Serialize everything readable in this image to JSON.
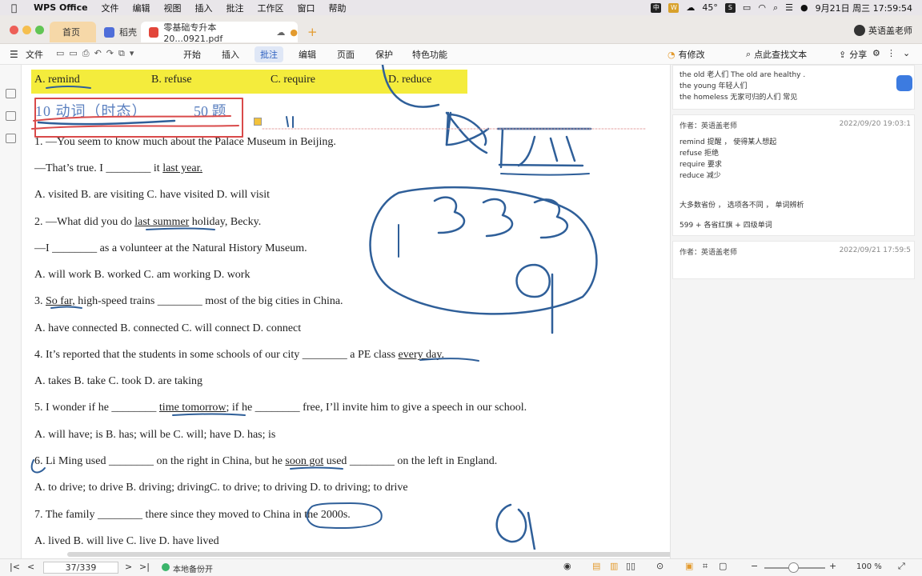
{
  "menubar": {
    "app": "WPS Office",
    "items": [
      "文件",
      "编辑",
      "视图",
      "插入",
      "批注",
      "工作区",
      "窗口",
      "帮助"
    ],
    "temp": "45°",
    "datetime": "9月21日 周三  17:59:54"
  },
  "tabs": {
    "home": "首页",
    "daoke": "稻壳",
    "doc": "零基础专升本20...0921.pdf"
  },
  "user": "英语盖老师",
  "toolbar": {
    "file": "文件",
    "menus": [
      "开始",
      "插入",
      "批注",
      "编辑",
      "页面",
      "保护",
      "特色功能"
    ],
    "active": "批注",
    "changes": "有修改",
    "search": "点此查找文本",
    "share": "分享"
  },
  "doc": {
    "options_top": [
      "A.  remind",
      "B.  refuse",
      "C.  require",
      "D.  reduce"
    ],
    "heading": "10   动词（时态）",
    "heading_count": "50 题",
    "q1a": "1.  —You seem to know much about the Palace Museum in Beijing.",
    "q1b_pre": "—That’s true. I ________ it ",
    "q1b_ul": "last year.",
    "q1opts": "A.  visited      B.  are visiting      C.  have visited      D.  will visit",
    "q2a_pre": "2.  —What did you do ",
    "q2a_ul": "last summer",
    "q2a_post": " holiday, Becky.",
    "q2b": "—I ________ as a volunteer at the Natural History Museum.",
    "q2opts": "A.  will work  B.  worked     C.  am working     D.  work",
    "q3_pre": "3.  ",
    "q3_ul": "So far,",
    "q3_post": " high-speed trains ________ most of the big cities in China.",
    "q3opts": "A.  have connected B.  connected C.  will connect     D.  connect",
    "q4_pre": "4.  It’s reported that the students in some schools of our city ________ a PE class ",
    "q4_ul": "every day.",
    "q4opts": "A.  takes B.  take  C.  took  D.  are taking",
    "q5_pre": "5.  I wonder if he ________ ",
    "q5_ul": "time tomorrow",
    "q5_post": "; if he ________ free, I’ll invite him to give a speech in our school.",
    "q5opts": "A.  will have; is      B.  has; will be       C.  will; have  D.  has;       is",
    "q6_pre": "6.  Li Ming used ________ on the right in China, but he ",
    "q6_ul": "soon got",
    "q6_post": " used ________ on the left in England.",
    "q6opts": "A.  to drive; to drive      B.  driving; drivingC.  to drive; to driving   D.  to driving; to drive",
    "q7": "7.  The family ________ there since they moved to China in the 2000s.",
    "q7opts": "A.  lived B.  will live   C.  live   D.  have lived"
  },
  "comments": {
    "c0": [
      "the  old  老人们          The   old   are  healthy .",
      "the young  年轻人们",
      "the homeless  无家可归的人们               常见"
    ],
    "c1": {
      "author": "作者：英语盖老师",
      "time": "2022/09/20 19:03:1",
      "lines": [
        "remind   提醒 ，  使得某人想起",
        "refuse 拒绝",
        "require 要求",
        "reduce  减少",
        "大多数省份 ，  选项各不同 ，  单词辨析",
        "599  +  各省红旗  +   四级单词"
      ]
    },
    "c2": {
      "author": "作者：英语盖老师",
      "time": "2022/09/21 17:59:5"
    }
  },
  "status": {
    "page": "37/339",
    "backup": "本地备份开",
    "zoom": "100 %"
  }
}
